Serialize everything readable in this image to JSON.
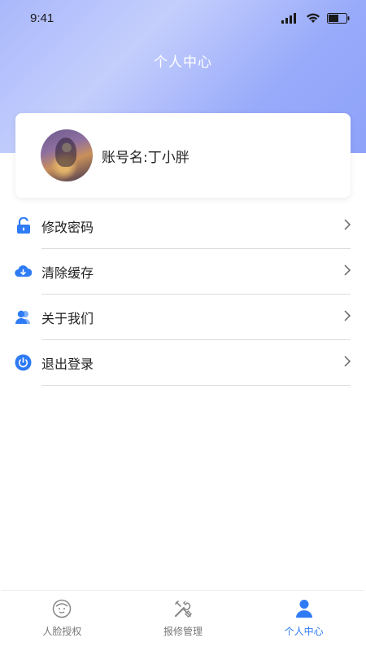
{
  "status_bar": {
    "time": "9:41"
  },
  "header": {
    "title": "个人中心"
  },
  "profile": {
    "account_name": "账号名:丁小胖"
  },
  "menu": {
    "items": [
      {
        "label": "修改密码",
        "icon": "unlock-icon"
      },
      {
        "label": "清除缓存",
        "icon": "cloud-download-icon"
      },
      {
        "label": "关于我们",
        "icon": "users-icon"
      },
      {
        "label": "退出登录",
        "icon": "power-icon"
      }
    ]
  },
  "tabbar": {
    "items": [
      {
        "label": "人脸授权",
        "icon": "face-icon",
        "active": false
      },
      {
        "label": "报修管理",
        "icon": "tools-icon",
        "active": false
      },
      {
        "label": "个人中心",
        "icon": "person-icon",
        "active": true
      }
    ]
  },
  "colors": {
    "accent": "#2f7bf5",
    "header_gradient_start": "#a9b8fb",
    "header_gradient_end": "#8ea2f8"
  }
}
